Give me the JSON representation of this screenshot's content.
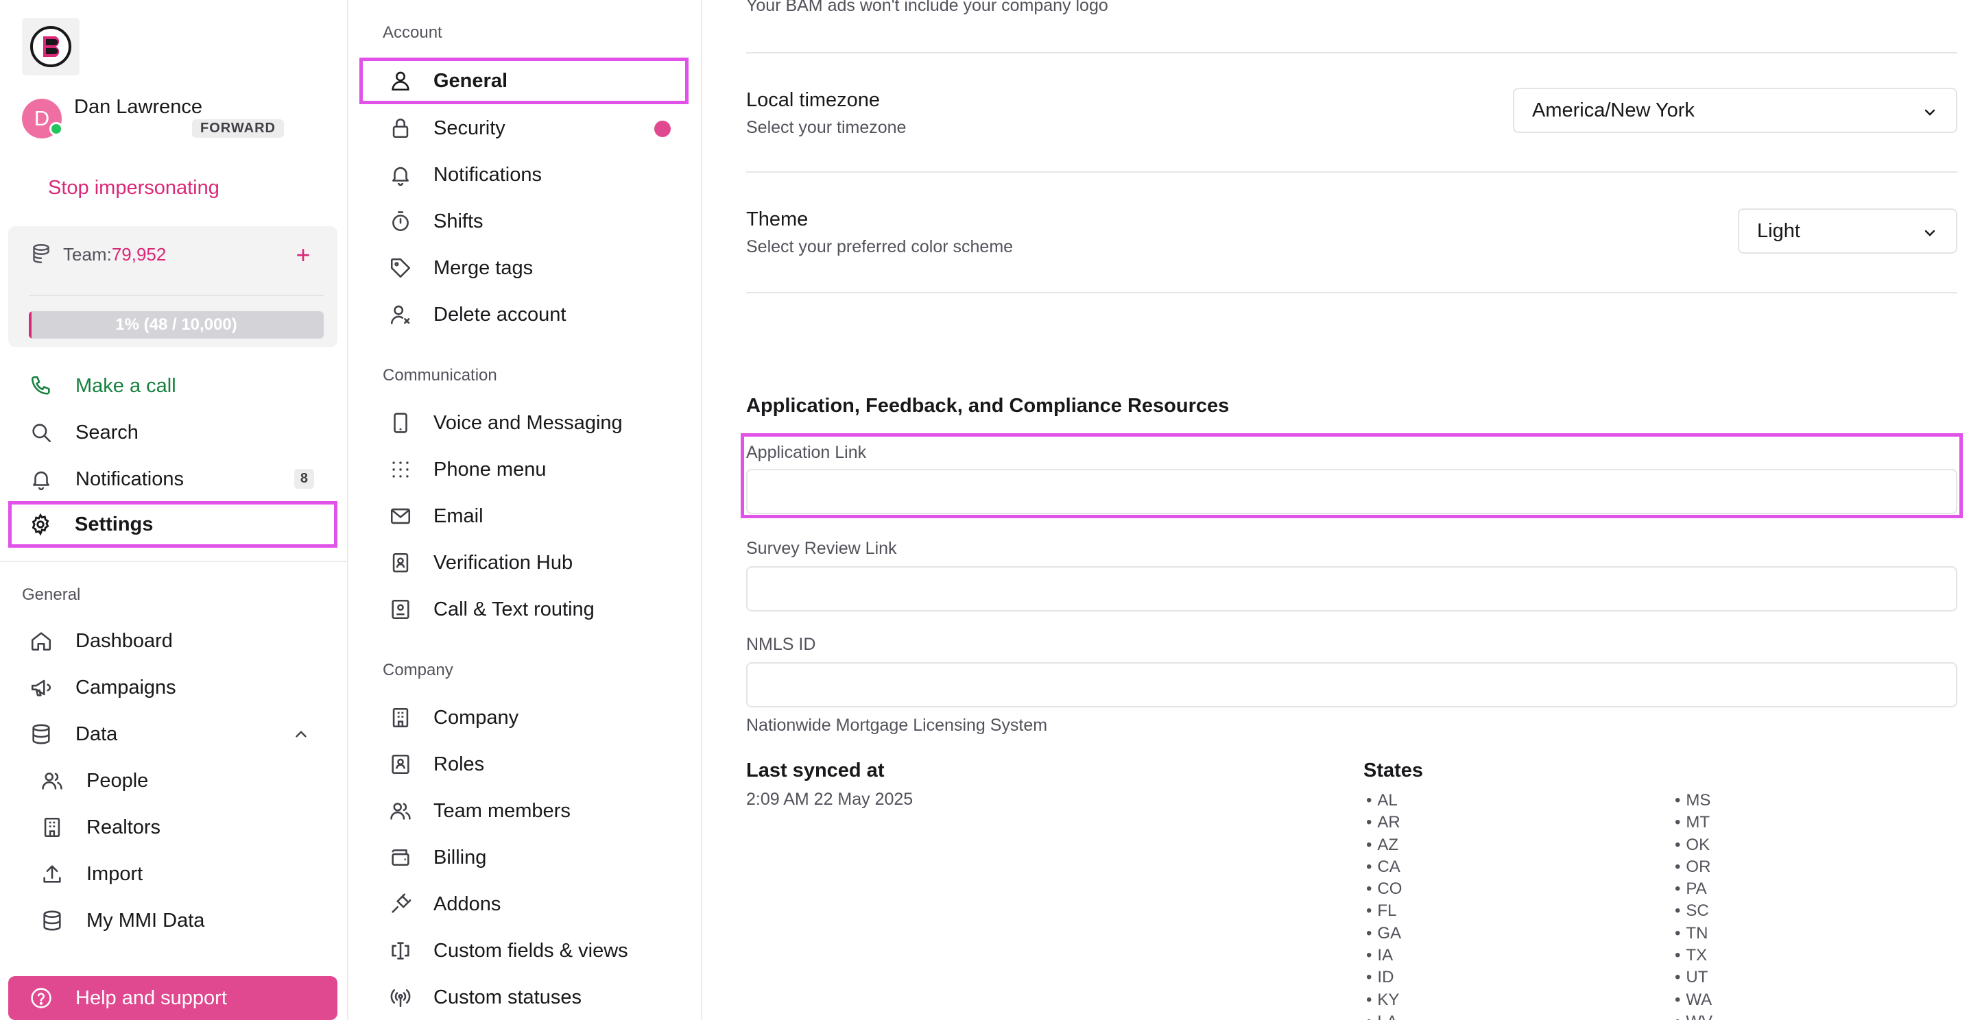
{
  "user": {
    "initial": "D",
    "name": "Dan Lawrence",
    "badge": "FORWARD",
    "stop_label": "Stop impersonating"
  },
  "team": {
    "label": "Team:",
    "value": "79,952",
    "add_symbol": "+",
    "usage_text": "1% (48 / 10,000)",
    "usage_fraction": 0.01
  },
  "nav": {
    "call": "Make a call",
    "search": "Search",
    "notifications": "Notifications",
    "notifications_count": "8",
    "settings": "Settings",
    "general_section": "General",
    "dashboard": "Dashboard",
    "campaigns": "Campaigns",
    "data": "Data",
    "people": "People",
    "realtors": "Realtors",
    "import": "Import",
    "my_mmi_data": "My MMI Data",
    "help": "Help and support"
  },
  "settings_menu": {
    "account_section": "Account",
    "general": "General",
    "security": "Security",
    "notifications": "Notifications",
    "shifts": "Shifts",
    "merge_tags": "Merge tags",
    "delete_account": "Delete account",
    "communication_section": "Communication",
    "voice_messaging": "Voice and Messaging",
    "phone_menu": "Phone menu",
    "email": "Email",
    "verification_hub": "Verification Hub",
    "call_text_routing": "Call & Text routing",
    "company_section": "Company",
    "company": "Company",
    "roles": "Roles",
    "team_members": "Team members",
    "billing": "Billing",
    "addons": "Addons",
    "custom_fields_views": "Custom fields & views",
    "custom_statuses": "Custom statuses"
  },
  "main": {
    "logo_note": "Your BAM ads won't include your company logo",
    "timezone_title": "Local timezone",
    "timezone_sub": "Select your timezone",
    "timezone_value": "America/New York",
    "theme_title": "Theme",
    "theme_sub": "Select your preferred color scheme",
    "theme_value": "Light",
    "resources_heading": "Application, Feedback, and Compliance Resources",
    "application_link_label": "Application Link",
    "application_link_value": "",
    "survey_link_label": "Survey Review Link",
    "survey_link_value": "",
    "nmls_label": "NMLS ID",
    "nmls_value": "",
    "nmls_help": "Nationwide Mortgage Licensing System",
    "last_synced_title": "Last synced at",
    "last_synced_value": "2:09 AM 22 May 2025",
    "states_title": "States",
    "states_col1": [
      "AL",
      "AR",
      "AZ",
      "CA",
      "CO",
      "FL",
      "GA",
      "IA",
      "ID",
      "KY",
      "LA"
    ],
    "states_col2": [
      "MS",
      "MT",
      "OK",
      "OR",
      "PA",
      "SC",
      "TN",
      "TX",
      "UT",
      "WA",
      "WV"
    ]
  },
  "colors": {
    "brand_pink": "#db2777",
    "highlight": "#e052e8",
    "call_green": "#15803d",
    "help_bg": "#e0498f"
  }
}
